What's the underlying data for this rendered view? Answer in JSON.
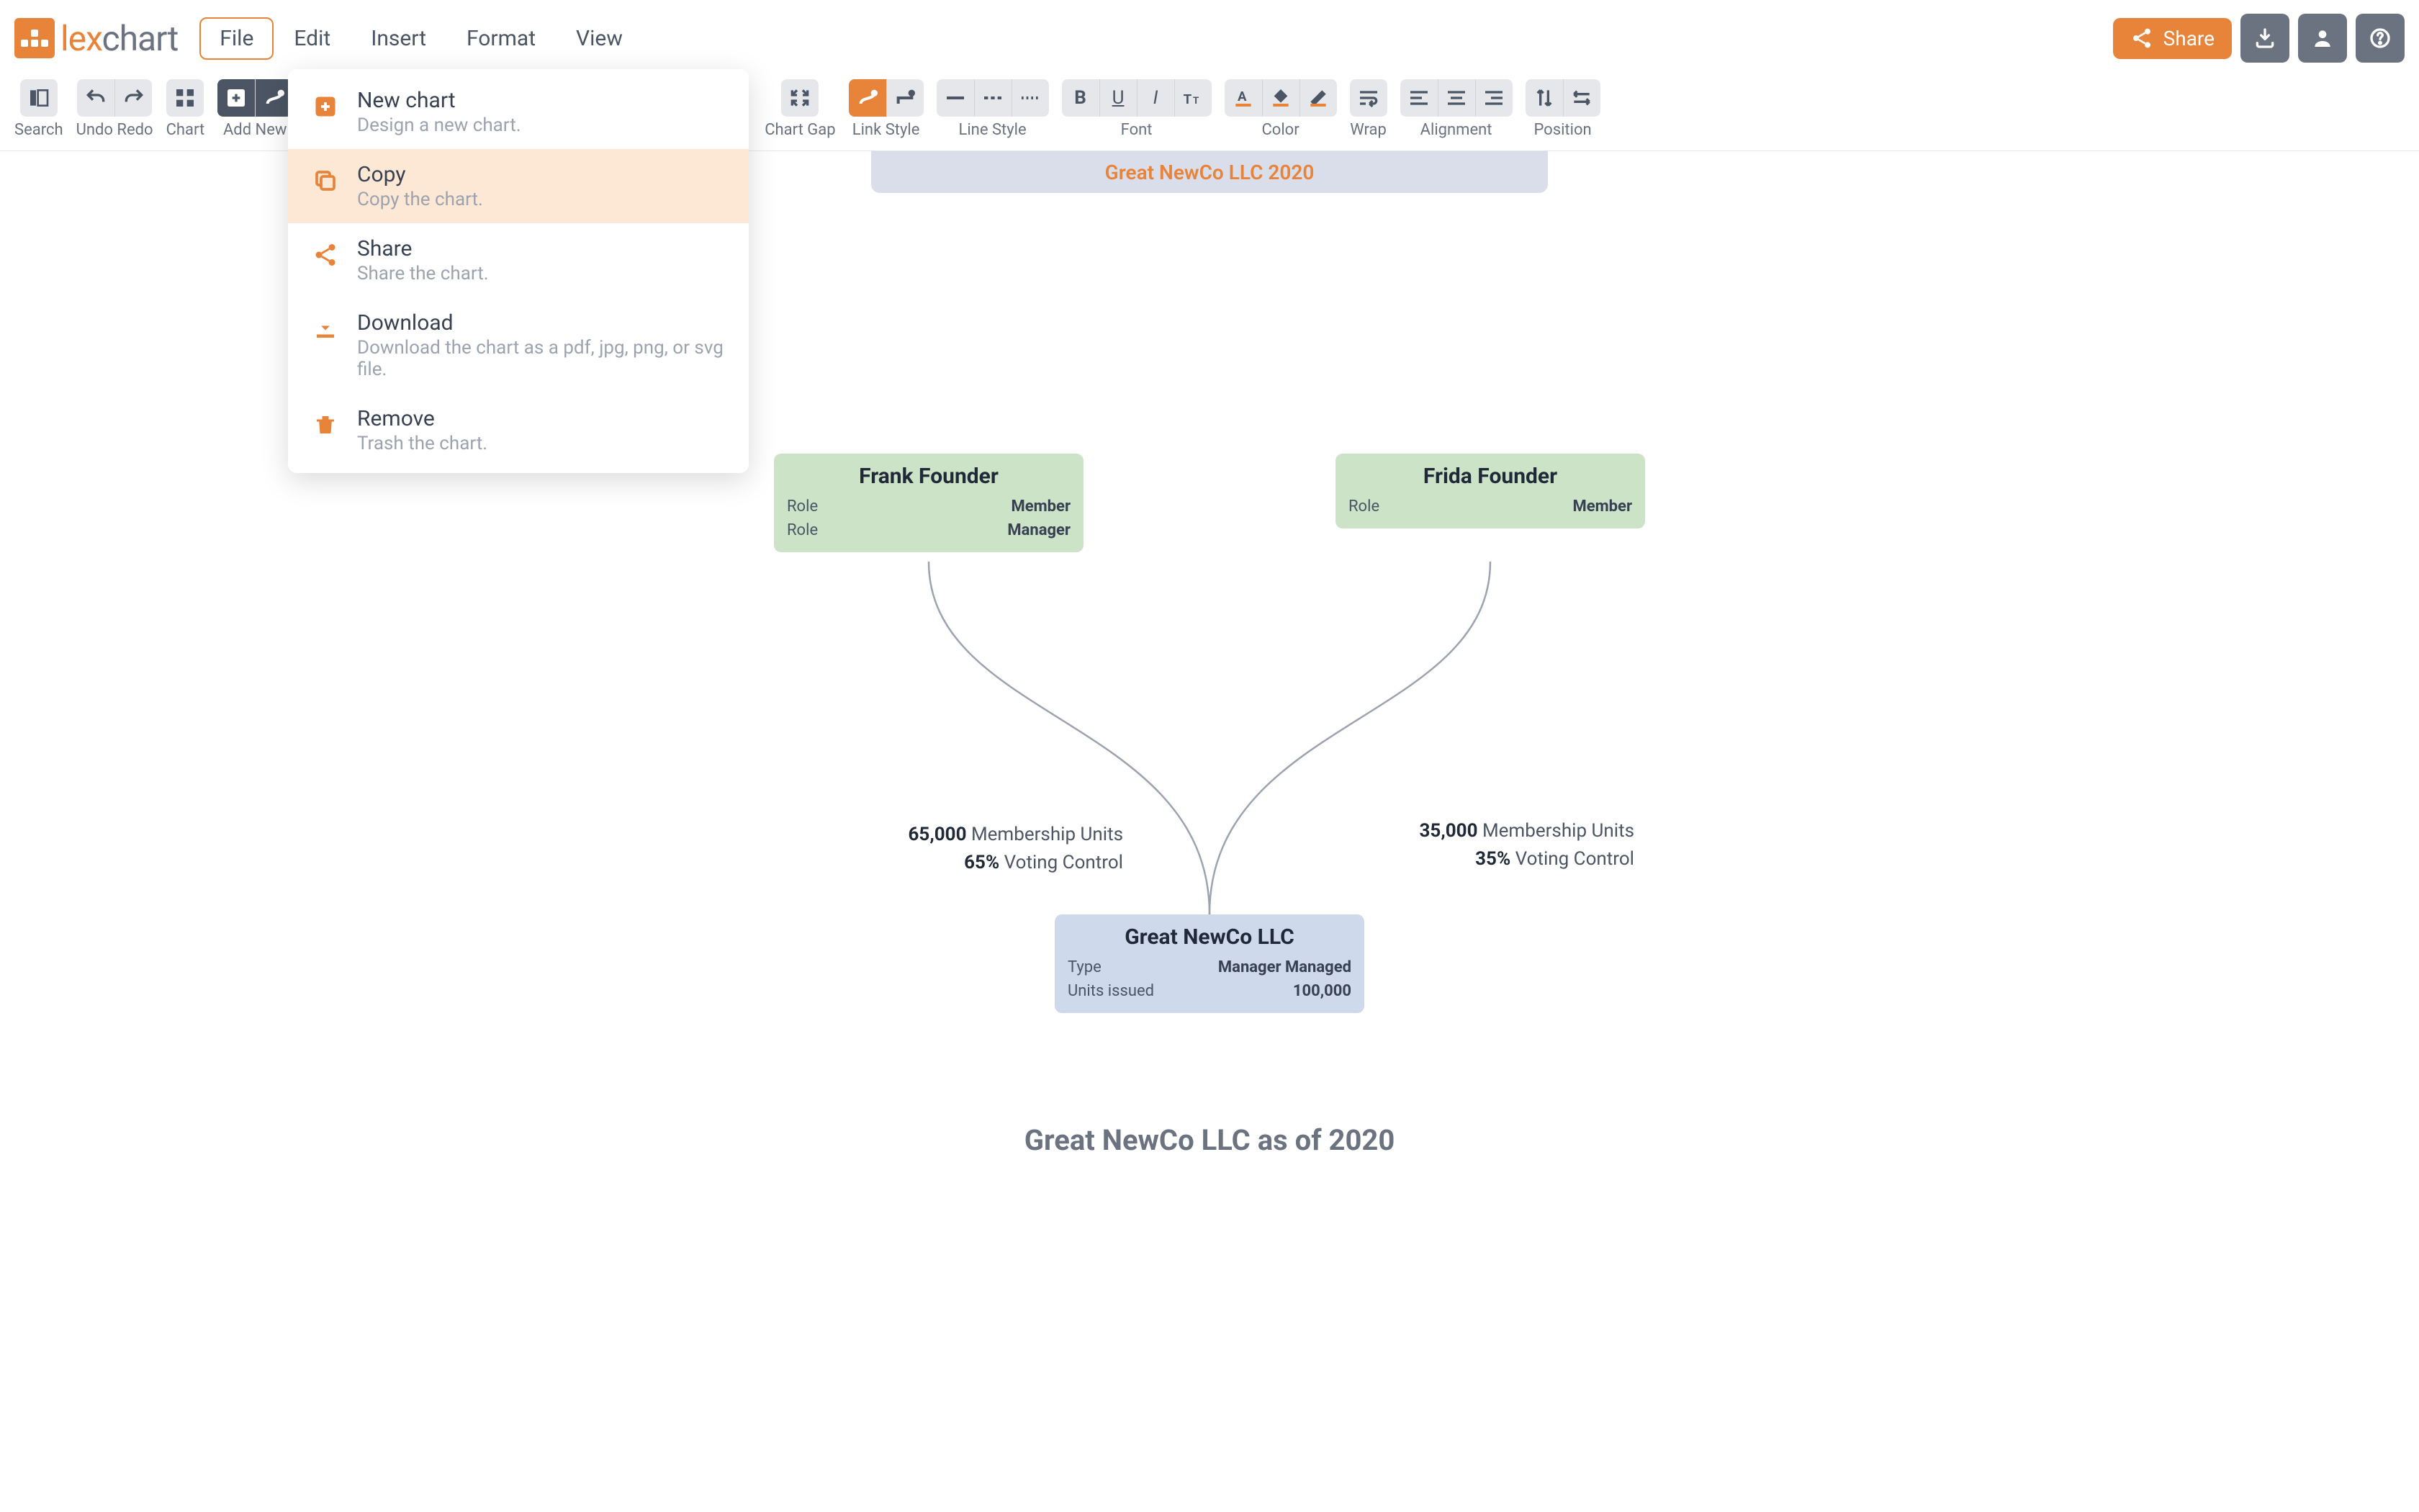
{
  "brand": {
    "name_part1": "lex",
    "name_part2": "chart"
  },
  "menubar": {
    "file": "File",
    "edit": "Edit",
    "insert": "Insert",
    "format": "Format",
    "view": "View"
  },
  "topright": {
    "share": "Share"
  },
  "toolbar": {
    "search": "Search",
    "undoredo": "Undo Redo",
    "chart": "Chart",
    "addnew": "Add New",
    "chartgap": "Chart Gap",
    "linkstyle": "Link Style",
    "linestyle": "Line Style",
    "font": "Font",
    "color": "Color",
    "wrap": "Wrap",
    "alignment": "Alignment",
    "position": "Position"
  },
  "dropdown": {
    "items": [
      {
        "title": "New chart",
        "desc": "Design a new chart.",
        "icon": "plus-square-icon"
      },
      {
        "title": "Copy",
        "desc": "Copy the chart.",
        "icon": "copy-icon",
        "highlight": true
      },
      {
        "title": "Share",
        "desc": "Share the chart.",
        "icon": "share-icon"
      },
      {
        "title": "Download",
        "desc": "Download the chart as a pdf, jpg, png, or svg file.",
        "icon": "download-icon"
      },
      {
        "title": "Remove",
        "desc": "Trash the chart.",
        "icon": "trash-icon"
      }
    ]
  },
  "chart": {
    "title_bar": "Great NewCo LLC 2020",
    "caption": "Great NewCo LLC as of 2020",
    "nodes": {
      "frank": {
        "name": "Frank Founder",
        "rows": [
          {
            "label": "Role",
            "value": "Member"
          },
          {
            "label": "Role",
            "value": "Manager"
          }
        ]
      },
      "frida": {
        "name": "Frida Founder",
        "rows": [
          {
            "label": "Role",
            "value": "Member"
          }
        ]
      },
      "company": {
        "name": "Great NewCo LLC",
        "rows": [
          {
            "label": "Type",
            "value": "Manager Managed"
          },
          {
            "label": "Units issued",
            "value": "100,000"
          }
        ]
      }
    },
    "edges": {
      "left": {
        "units_val": "65,000",
        "units_label": "Membership Units",
        "voting_val": "65%",
        "voting_label": "Voting Control"
      },
      "right": {
        "units_val": "35,000",
        "units_label": "Membership Units",
        "voting_val": "35%",
        "voting_label": "Voting Control"
      }
    }
  },
  "chart_data": {
    "type": "org-diagram",
    "title": "Great NewCo LLC 2020",
    "caption": "Great NewCo LLC as of 2020",
    "nodes": [
      {
        "id": "frank",
        "label": "Frank Founder",
        "attrs": {
          "Role": [
            "Member",
            "Manager"
          ]
        },
        "color": "#cde3c7"
      },
      {
        "id": "frida",
        "label": "Frida Founder",
        "attrs": {
          "Role": [
            "Member"
          ]
        },
        "color": "#cde3c7"
      },
      {
        "id": "company",
        "label": "Great NewCo LLC",
        "attrs": {
          "Type": "Manager Managed",
          "Units issued": 100000
        },
        "color": "#ced9ec"
      }
    ],
    "edges": [
      {
        "from": "frank",
        "to": "company",
        "membership_units": 65000,
        "voting_control_pct": 65
      },
      {
        "from": "frida",
        "to": "company",
        "membership_units": 35000,
        "voting_control_pct": 35
      }
    ]
  }
}
